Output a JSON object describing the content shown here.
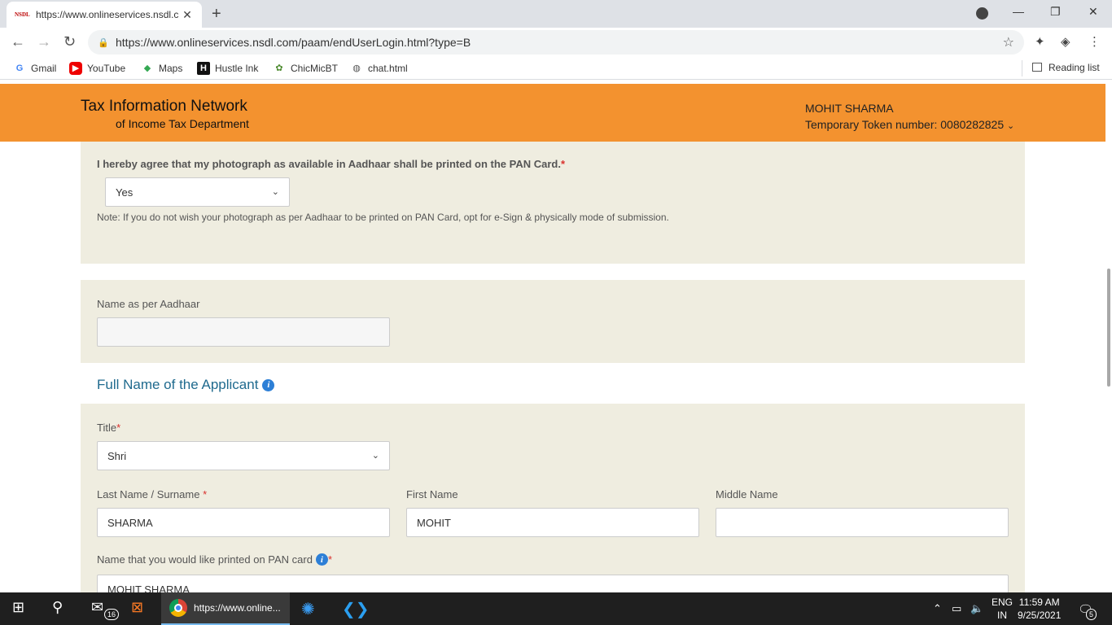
{
  "browser": {
    "tab_title": "https://www.onlineservices.nsdl.c",
    "tab_favicon_text": "NSDL",
    "url": "https://www.onlineservices.nsdl.com/paam/endUserLogin.html?type=B",
    "bookmarks": [
      {
        "label": "Gmail",
        "icon": "gmail-icon"
      },
      {
        "label": "YouTube",
        "icon": "youtube-icon"
      },
      {
        "label": "Maps",
        "icon": "maps-icon"
      },
      {
        "label": "Hustle Ink",
        "icon": "hustle-ink-icon"
      },
      {
        "label": "ChicMicBT",
        "icon": "chicmic-icon"
      },
      {
        "label": "chat.html",
        "icon": "globe-icon"
      }
    ],
    "reading_list": "Reading list"
  },
  "header": {
    "brand_line1": "Tax Information Network",
    "brand_line2": "of Income Tax Department",
    "user_name": "MOHIT SHARMA",
    "token": "Temporary Token number: 0080282825"
  },
  "photo_consent": {
    "label": "I hereby agree that my photograph as available in Aadhaar shall be printed on the PAN Card.",
    "required_mark": "*",
    "selected": "Yes",
    "note": "Note: If you do not wish your photograph as per Aadhaar to be printed on PAN Card, opt for e-Sign & physically mode of submission."
  },
  "aadhaar_name": {
    "label": "Name as per Aadhaar",
    "value": ""
  },
  "applicant": {
    "section_title": "Full Name of the Applicant",
    "title_label": "Title",
    "title_required": "*",
    "title_value": "Shri",
    "last_name_label": "Last Name / Surname",
    "last_name_required": "*",
    "last_name_value": "SHARMA",
    "first_name_label": "First Name",
    "first_name_value": "MOHIT",
    "middle_name_label": "Middle Name",
    "middle_name_value": "",
    "pan_name_label": "Name that you would like printed on PAN card",
    "pan_name_required": "*",
    "pan_name_value": "MOHIT SHARMA"
  },
  "taskbar": {
    "mail_badge": "16",
    "chrome_label": "https://www.online...",
    "lang_line1": "ENG",
    "lang_line2": "IN",
    "time": "11:59 AM",
    "date": "9/25/2021",
    "notif_count": "5"
  },
  "colors": {
    "header_orange": "#f3922f",
    "panel_beige": "#efede0",
    "section_title": "#1f6a8e",
    "required": "#d9302c",
    "info_icon": "#2d7fd6"
  }
}
